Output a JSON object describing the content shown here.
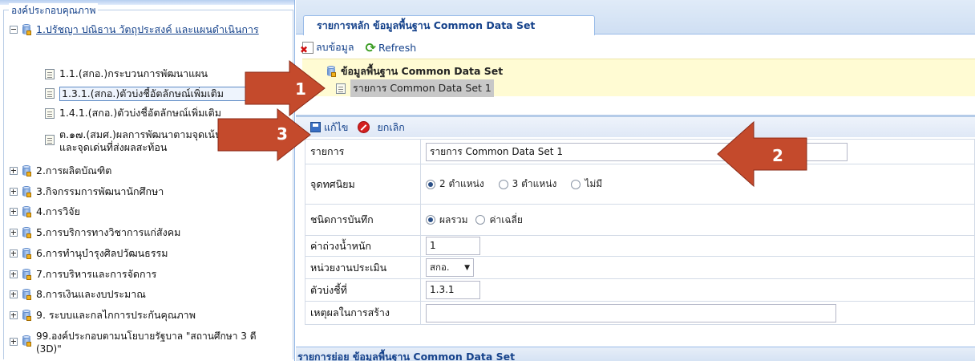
{
  "left_panel": {
    "legend": "องค์ประกอบคุณภาพ",
    "nodes": [
      {
        "label": "1.ปรัชญา ปณิธาน วัตถุประสงค์ และแผนดำเนินการ",
        "expanded": true
      },
      {
        "label": "1.1.(สกอ.)กระบวนการพัฒนาแผน"
      },
      {
        "label": "1.3.1.(สกอ.)ตัวบ่งชี้อัตลักษณ์เพิ่มเติม"
      },
      {
        "label": "1.4.1.(สกอ.)ตัวบ่งชี้อัตลักษณ์เพิ่มเติม"
      },
      {
        "label": "ต.๑๗.(สมศ.)ผลการพัฒนาตามจุดเน้นและจุดเด่นที่ส่งผลสะท้อน"
      },
      {
        "label": "2.การผลิตบัณฑิต"
      },
      {
        "label": "3.กิจกรรมการพัฒนานักศึกษา"
      },
      {
        "label": "4.การวิจัย"
      },
      {
        "label": "5.การบริการทางวิชาการแก่สังคม"
      },
      {
        "label": "6.การทำนุบำรุงศิลปวัฒนธรรม"
      },
      {
        "label": "7.การบริหารและการจัดการ"
      },
      {
        "label": "8.การเงินและงบประมาณ"
      },
      {
        "label": "9. ระบบและกลไกการประกันคุณภาพ"
      },
      {
        "label": "99.องค์ประกอบตามนโยบายรัฐบาล \"สถานศึกษา 3 ดี (3D)\""
      }
    ]
  },
  "tab": {
    "label": "รายการหลัก ข้อมูลพื้นฐาน Common Data Set"
  },
  "toolbar": {
    "delete_label": "ลบข้อมูล",
    "refresh_label": "Refresh"
  },
  "tree": {
    "root": "ข้อมูลพื้นฐาน Common Data Set",
    "child": "รายการ Common Data Set 1"
  },
  "edit_toolbar": {
    "edit_label": "แก้ไข",
    "cancel_label": "ยกเลิก"
  },
  "form": {
    "item_label": "รายการ",
    "item_value": "รายการ Common Data Set 1",
    "decimal_label": "จุดทศนิยม",
    "decimal_options": [
      "2 ตำแหน่ง",
      "3 ตำแหน่ง",
      "ไม่มี"
    ],
    "record_label": "ชนิดการบันทึก",
    "record_options": [
      "ผลรวม",
      "ค่าเฉลี่ย"
    ],
    "weight_label": "ค่าถ่วงน้ำหนัก",
    "weight_value": "1",
    "unit_label": "หน่วยงานประเมิน",
    "unit_value": "สกอ.",
    "indicator_label": "ตัวบ่งชี้ที่",
    "indicator_value": "1.3.1",
    "reason_label": "เหตุผลในการสร้าง",
    "reason_value": ""
  },
  "subpanel": {
    "title": "รายการย่อย ข้อมูลพื้นฐาน Common Data Set"
  },
  "markers": {
    "one": "1",
    "two": "2",
    "three": "3"
  },
  "colors": {
    "accent": "#15428b",
    "arrow": "#c44a2c",
    "highlight": "#fffbd3"
  }
}
